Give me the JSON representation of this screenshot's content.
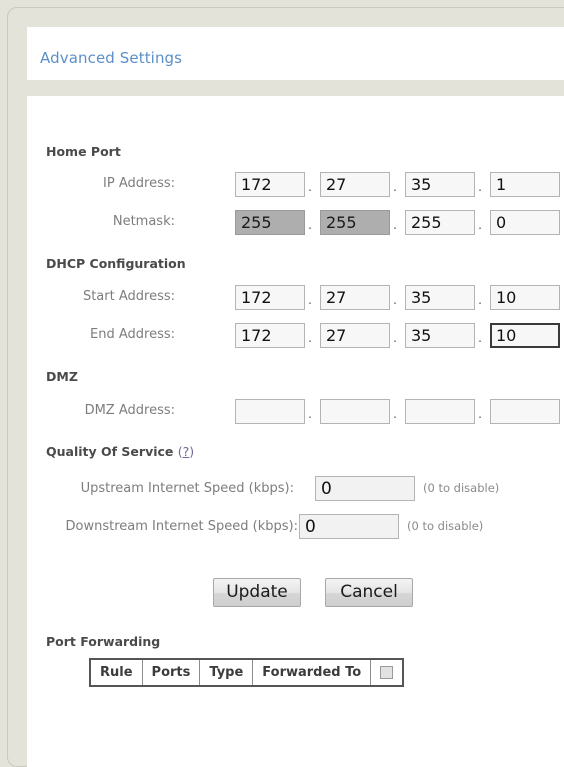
{
  "page": {
    "title": "Advanced Settings",
    "accent_color": "#5b8fc9",
    "panel_background": "#e3e3d9"
  },
  "sections": {
    "home_port": {
      "heading": "Home Port",
      "ip_address": {
        "label": "IP Address:",
        "octets": [
          "172",
          "27",
          "35",
          "1"
        ],
        "separator": "."
      },
      "netmask": {
        "label": "Netmask:",
        "octets": [
          "255",
          "255",
          "255",
          "0"
        ],
        "separator": "."
      }
    },
    "dhcp": {
      "heading": "DHCP Configuration",
      "start_address": {
        "label": "Start Address:",
        "octets": [
          "172",
          "27",
          "35",
          "10"
        ],
        "separator": "."
      },
      "end_address": {
        "label": "End Address:",
        "octets": [
          "172",
          "27",
          "35",
          "10"
        ],
        "separator": "."
      }
    },
    "dmz": {
      "heading": "DMZ",
      "dmz_address": {
        "label": "DMZ Address:",
        "octets": [
          "",
          "",
          "",
          ""
        ],
        "separator": "."
      }
    },
    "qos": {
      "heading": "Quality Of Service",
      "help_open": "(",
      "help_mark": "?",
      "help_close": ")",
      "upstream": {
        "label": "Upstream Internet Speed (kbps):",
        "value": "0",
        "hint": "(0 to disable)"
      },
      "downstream": {
        "label": "Downstream Internet Speed (kbps):",
        "value": "0",
        "hint": "(0 to disable)"
      }
    },
    "port_forwarding": {
      "heading": "Port Forwarding",
      "columns": [
        "Rule",
        "Ports",
        "Type",
        "Forwarded To"
      ],
      "select_all_checkbox": "unchecked"
    }
  },
  "buttons": {
    "update": "Update",
    "cancel": "Cancel"
  }
}
